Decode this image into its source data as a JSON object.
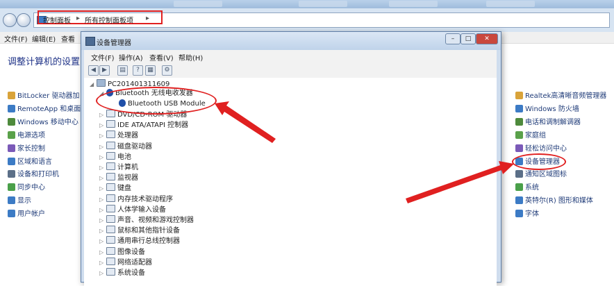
{
  "control_panel": {
    "breadcrumb": [
      "控制面板",
      "所有控制面板项"
    ],
    "menu": [
      "文件(F)",
      "编辑(E)",
      "查看"
    ],
    "heading": "调整计算机的设置",
    "left_items": [
      "BitLocker 驱动器加",
      "RemoteApp 和桌面",
      "Windows 移动中心",
      "电源选项",
      "家长控制",
      "区域和语言",
      "设备和打印机",
      "同步中心",
      "显示",
      "用户帐户"
    ],
    "right_items": [
      "Realtek高清晰音频管理器",
      "Windows 防火墙",
      "电话和调制解调器",
      "家庭组",
      "轻松访问中心",
      "设备管理器",
      "通知区域图标",
      "系统",
      "英特尔(R) 图形和媒体",
      "字体"
    ]
  },
  "device_manager": {
    "title": "设备管理器",
    "menu": [
      "文件(F)",
      "操作(A)",
      "查看(V)",
      "帮助(H)"
    ],
    "root": "PC201401311609",
    "bluetooth": {
      "label": "Bluetooth 无线电收发器",
      "child": "Bluetooth USB Module"
    },
    "categories": [
      "DVD/CD-ROM 驱动器",
      "IDE ATA/ATAPI 控制器",
      "处理器",
      "磁盘驱动器",
      "电池",
      "计算机",
      "监视器",
      "键盘",
      "内存技术驱动程序",
      "人体学输入设备",
      "声音、视频和游戏控制器",
      "鼠标和其他指针设备",
      "通用串行总线控制器",
      "图像设备",
      "网络适配器",
      "系统设备"
    ]
  },
  "colors": {
    "annotation": "#e02020",
    "link": "#1f3b78",
    "heading": "#1e3287"
  }
}
